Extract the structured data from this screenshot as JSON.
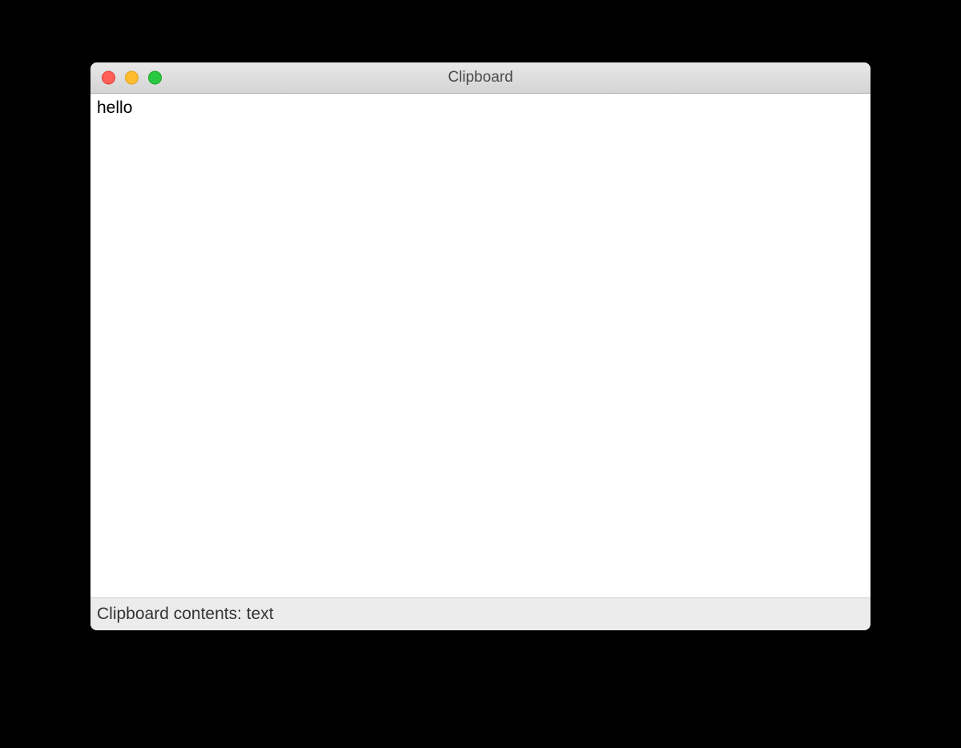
{
  "window": {
    "title": "Clipboard"
  },
  "content": {
    "text": "hello"
  },
  "statusbar": {
    "text": "Clipboard contents: text"
  }
}
